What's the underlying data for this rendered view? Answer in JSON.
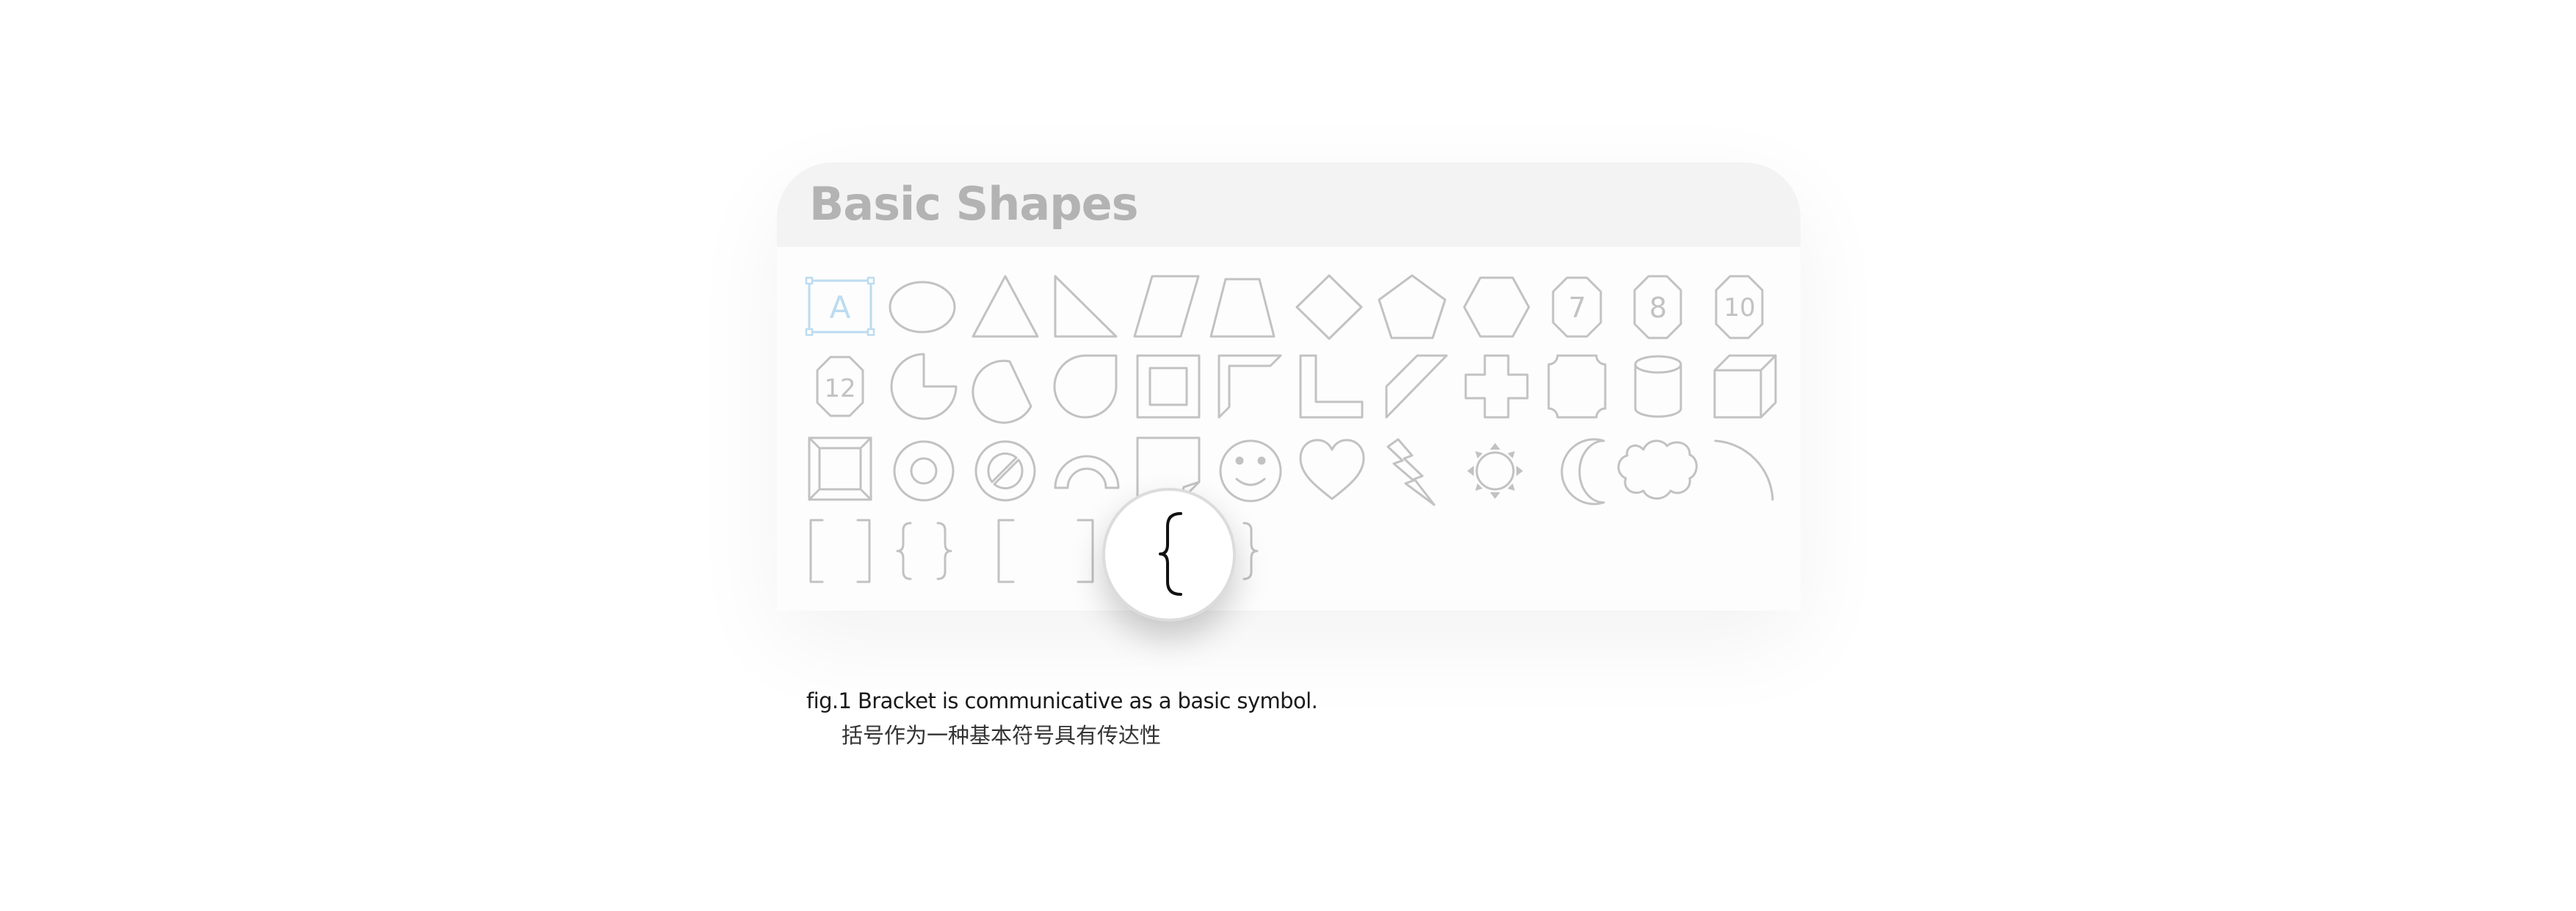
{
  "panel": {
    "title": "Basic Shapes"
  },
  "shapes": [
    {
      "icon": "text-box-icon",
      "label": "A",
      "selected": true
    },
    {
      "icon": "ellipse-icon"
    },
    {
      "icon": "triangle-icon"
    },
    {
      "icon": "right-triangle-icon"
    },
    {
      "icon": "parallelogram-icon"
    },
    {
      "icon": "trapezoid-icon"
    },
    {
      "icon": "diamond-icon"
    },
    {
      "icon": "pentagon-icon"
    },
    {
      "icon": "hexagon-icon"
    },
    {
      "icon": "heptagon-icon",
      "label": "7"
    },
    {
      "icon": "octagon-icon",
      "label": "8"
    },
    {
      "icon": "decagon-icon",
      "label": "10"
    },
    {
      "icon": "dodecagon-icon",
      "label": "12"
    },
    {
      "icon": "pie-icon"
    },
    {
      "icon": "chord-icon"
    },
    {
      "icon": "teardrop-icon"
    },
    {
      "icon": "frame-icon"
    },
    {
      "icon": "half-frame-icon"
    },
    {
      "icon": "l-shape-icon"
    },
    {
      "icon": "diagonal-stripe-icon"
    },
    {
      "icon": "cross-icon"
    },
    {
      "icon": "plaque-icon"
    },
    {
      "icon": "can-icon"
    },
    {
      "icon": "cube-icon"
    },
    {
      "icon": "bevel-icon"
    },
    {
      "icon": "donut-icon"
    },
    {
      "icon": "no-symbol-icon"
    },
    {
      "icon": "block-arc-icon"
    },
    {
      "icon": "folded-corner-icon"
    },
    {
      "icon": "smiley-face-icon"
    },
    {
      "icon": "heart-icon"
    },
    {
      "icon": "lightning-bolt-icon"
    },
    {
      "icon": "sun-icon"
    },
    {
      "icon": "moon-icon"
    },
    {
      "icon": "cloud-icon"
    },
    {
      "icon": "arc-icon"
    },
    {
      "icon": "double-bracket-icon"
    },
    {
      "icon": "double-brace-icon"
    },
    {
      "icon": "left-bracket-icon"
    },
    {
      "icon": "right-bracket-icon"
    },
    {
      "icon": "left-brace-icon"
    },
    {
      "icon": "right-brace-icon"
    }
  ],
  "magnifier": {
    "icon": "left-brace-icon"
  },
  "caption": {
    "en": "fig.1 Bracket is communicative as a basic symbol.",
    "zh": "括号作为一种基本符号具有传达性"
  },
  "colors": {
    "shape_stroke": "#c2c2c2",
    "selection": "#bcdcf0",
    "header_bg": "#f3f3f3",
    "title": "#b3b3b3",
    "magnified_stroke": "#111111"
  }
}
